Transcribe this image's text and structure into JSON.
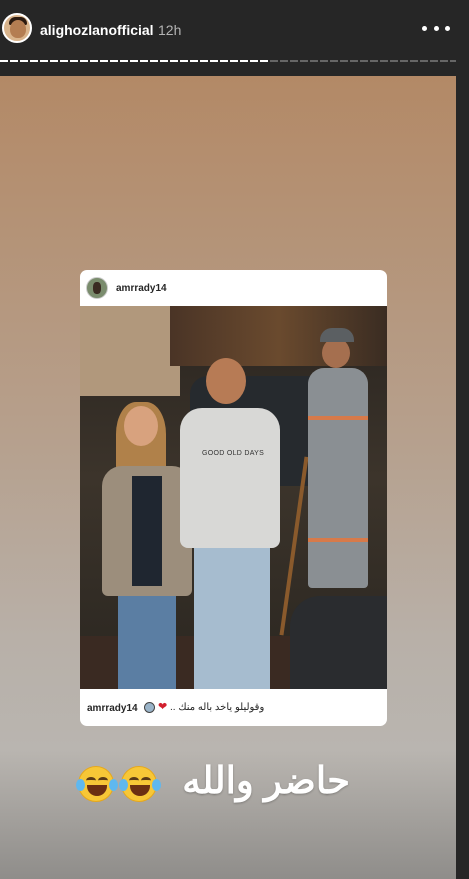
{
  "header": {
    "username": "alighozlanofficial",
    "time": "12h",
    "more_icon": "more-horizontal-icon"
  },
  "progress": {
    "segments_fraction_complete": 0.59
  },
  "colors": {
    "background": "#262626",
    "canvas_top": "#b38966",
    "canvas_bottom": "#8f8d8a",
    "heart": "#d2202e",
    "emoji": "#f7c737"
  },
  "shared_post": {
    "username": "amrrady14",
    "photo_text": "GOOD OLD DAYS",
    "caption": {
      "username": "amrrady14",
      "emoji_icon": "man-face-emoji",
      "heart_icon": "red-heart-emoji",
      "text": "وقوليلو ياخد باله منك .."
    }
  },
  "story": {
    "text": "حاضر والله",
    "emoji_icon": "laughing-tears-emoji"
  }
}
